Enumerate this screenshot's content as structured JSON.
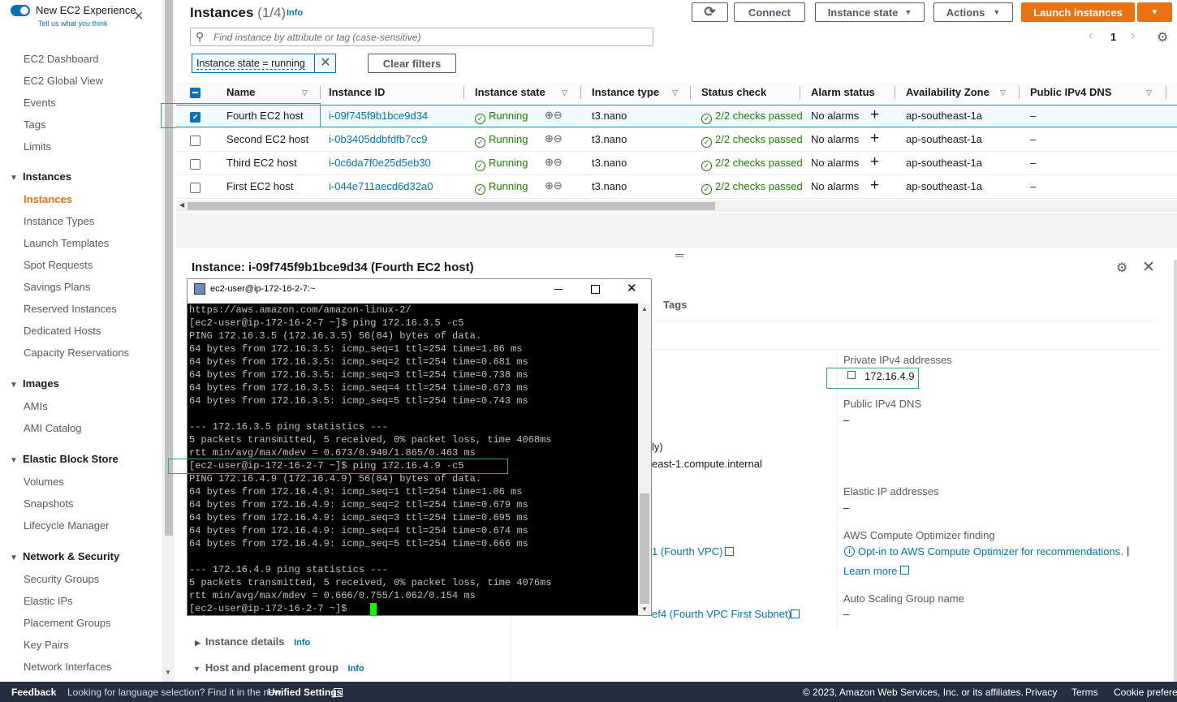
{
  "toggle": {
    "title": "New EC2 Experience",
    "subtitle": "Tell us what you think"
  },
  "sidebar": {
    "top_items": [
      "EC2 Dashboard",
      "EC2 Global View",
      "Events",
      "Tags",
      "Limits"
    ],
    "sections": [
      {
        "title": "Instances",
        "items": [
          "Instances",
          "Instance Types",
          "Launch Templates",
          "Spot Requests",
          "Savings Plans",
          "Reserved Instances",
          "Dedicated Hosts",
          "Capacity Reservations"
        ]
      },
      {
        "title": "Images",
        "items": [
          "AMIs",
          "AMI Catalog"
        ]
      },
      {
        "title": "Elastic Block Store",
        "items": [
          "Volumes",
          "Snapshots",
          "Lifecycle Manager"
        ]
      },
      {
        "title": "Network & Security",
        "items": [
          "Security Groups",
          "Elastic IPs",
          "Placement Groups",
          "Key Pairs",
          "Network Interfaces"
        ]
      }
    ],
    "active": "Instances"
  },
  "header": {
    "title": "Instances",
    "count": "(1/4)",
    "info": "Info",
    "connect": "Connect",
    "instance_state": "Instance state",
    "actions": "Actions",
    "launch": "Launch instances",
    "search_placeholder": "Find instance by attribute or tag (case-sensitive)",
    "filter_chip": "Instance state = running",
    "clear_filters": "Clear filters",
    "page": "1"
  },
  "table": {
    "columns": [
      "Name",
      "Instance ID",
      "Instance state",
      "Instance type",
      "Status check",
      "Alarm status",
      "Availability Zone",
      "Public IPv4 DNS"
    ],
    "rows": [
      {
        "name": "Fourth EC2 host",
        "id": "i-09f745f9b1bce9d34",
        "state": "Running",
        "type": "t3.nano",
        "status": "2/2 checks passed",
        "alarm": "No alarms",
        "az": "ap-southeast-1a",
        "dns": "–",
        "selected": true
      },
      {
        "name": "Second EC2 host",
        "id": "i-0b3405ddbfdfb7cc9",
        "state": "Running",
        "type": "t3.nano",
        "status": "2/2 checks passed",
        "alarm": "No alarms",
        "az": "ap-southeast-1a",
        "dns": "–",
        "selected": false
      },
      {
        "name": "Third EC2 host",
        "id": "i-0c6da7f0e25d5eb30",
        "state": "Running",
        "type": "t3.nano",
        "status": "2/2 checks passed",
        "alarm": "No alarms",
        "az": "ap-southeast-1a",
        "dns": "–",
        "selected": false
      },
      {
        "name": "First EC2 host",
        "id": "i-044e711aecd6d32a0",
        "state": "Running",
        "type": "t3.nano",
        "status": "2/2 checks passed",
        "alarm": "No alarms",
        "az": "ap-southeast-1a",
        "dns": "–",
        "selected": false
      }
    ]
  },
  "detail": {
    "title": "Instance: i-09f745f9b1bce9d34 (Fourth EC2 host)",
    "tab_tags": "Tags",
    "private_ipv4_label": "Private IPv4 addresses",
    "private_ipv4": "172.16.4.9",
    "public_dns_label": "Public IPv4 DNS",
    "public_dns": "–",
    "partial_1": "ly)",
    "partial_2": "east-1.compute.internal",
    "elastic_ip_label": "Elastic IP addresses",
    "elastic_ip": "–",
    "optimizer_label": "AWS Compute Optimizer finding",
    "optimizer_link": "Opt-in to AWS Compute Optimizer for recommendations.",
    "learn_more": "Learn more",
    "vpc_partial": "1 (Fourth VPC)",
    "subnet_partial": "ef4 (Fourth VPC First Subnet)",
    "asg_label": "Auto Scaling Group name",
    "asg": "–",
    "instance_details": "Instance details",
    "host_placement": "Host and placement group",
    "info": "Info"
  },
  "terminal": {
    "title": "ec2-user@ip-172-16-2-7:~",
    "lines": [
      "https://aws.amazon.com/amazon-linux-2/",
      "[ec2-user@ip-172-16-2-7 ~]$ ping 172.16.3.5 -c5",
      "PING 172.16.3.5 (172.16.3.5) 56(84) bytes of data.",
      "64 bytes from 172.16.3.5: icmp_seq=1 ttl=254 time=1.86 ms",
      "64 bytes from 172.16.3.5: icmp_seq=2 ttl=254 time=0.681 ms",
      "64 bytes from 172.16.3.5: icmp_seq=3 ttl=254 time=0.738 ms",
      "64 bytes from 172.16.3.5: icmp_seq=4 ttl=254 time=0.673 ms",
      "64 bytes from 172.16.3.5: icmp_seq=5 ttl=254 time=0.743 ms",
      "",
      "--- 172.16.3.5 ping statistics ---",
      "5 packets transmitted, 5 received, 0% packet loss, time 4068ms",
      "rtt min/avg/max/mdev = 0.673/0.940/1.865/0.463 ms",
      "[ec2-user@ip-172-16-2-7 ~]$ ping 172.16.4.9 -c5",
      "PING 172.16.4.9 (172.16.4.9) 56(84) bytes of data.",
      "64 bytes from 172.16.4.9: icmp_seq=1 ttl=254 time=1.06 ms",
      "64 bytes from 172.16.4.9: icmp_seq=2 ttl=254 time=0.679 ms",
      "64 bytes from 172.16.4.9: icmp_seq=3 ttl=254 time=0.695 ms",
      "64 bytes from 172.16.4.9: icmp_seq=4 ttl=254 time=0.674 ms",
      "64 bytes from 172.16.4.9: icmp_seq=5 ttl=254 time=0.666 ms",
      "",
      "--- 172.16.4.9 ping statistics ---",
      "5 packets transmitted, 5 received, 0% packet loss, time 4076ms",
      "rtt min/avg/max/mdev = 0.666/0.755/1.062/0.154 ms",
      "[ec2-user@ip-172-16-2-7 ~]$ "
    ]
  },
  "footer": {
    "feedback": "Feedback",
    "language": "Looking for language selection? Find it in the new",
    "unified": "Unified Settings",
    "copyright": "© 2023, Amazon Web Services, Inc. or its affiliates.",
    "privacy": "Privacy",
    "terms": "Terms",
    "cookie": "Cookie preferen"
  },
  "colors": {
    "accent": "#ec7211",
    "link": "#0073bb",
    "success": "#1d8102",
    "highlight": "#2ba58a"
  }
}
